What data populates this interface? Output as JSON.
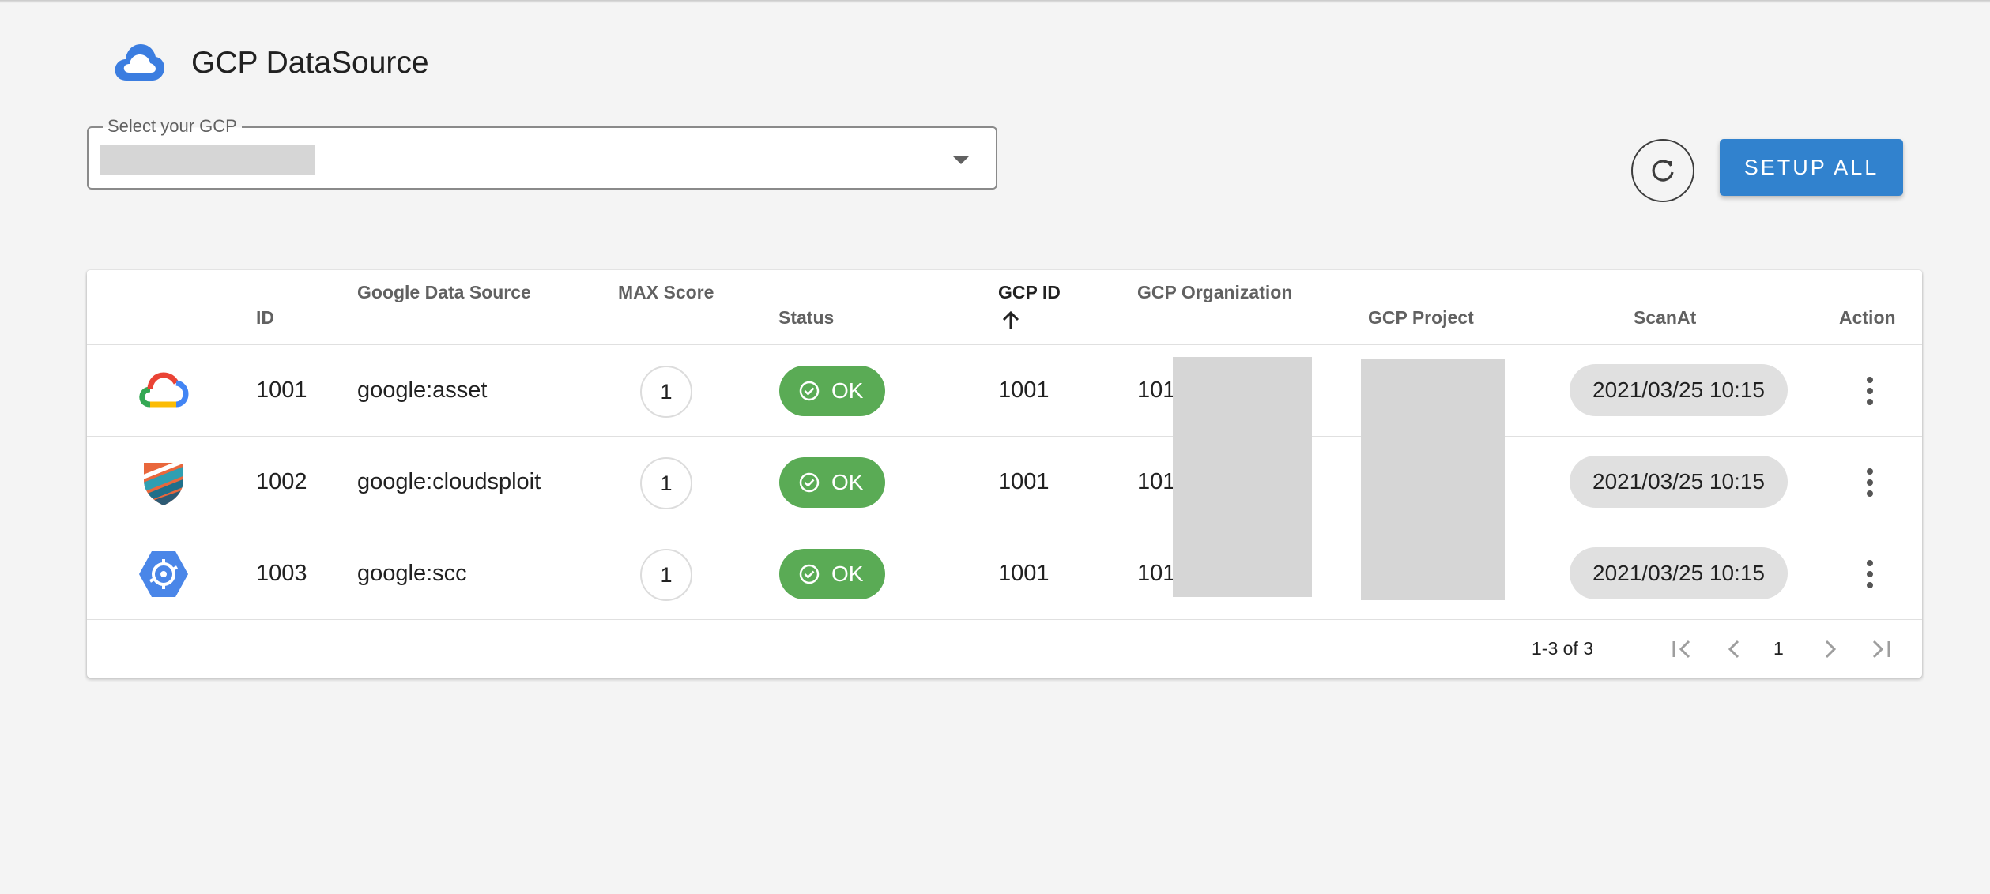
{
  "header": {
    "title": "GCP DataSource",
    "logo_icon": "google-cloud-logo-icon"
  },
  "gcp_select": {
    "label": "Select your GCP",
    "value": ""
  },
  "actions": {
    "refresh_icon": "refresh-icon",
    "setup_all_label": "SETUP ALL"
  },
  "table": {
    "columns": [
      "ID",
      "Google Data Source",
      "MAX Score",
      "Status",
      "GCP ID",
      "GCP Organization",
      "GCP Project",
      "ScanAt",
      "Action"
    ],
    "sort": {
      "column": "GCP ID",
      "direction": "ascending",
      "icon": "arrow-up-icon"
    },
    "rows": [
      {
        "icon": "google-cloud-icon",
        "id": "1001",
        "source": "google:asset",
        "max_score": "1",
        "status": "OK",
        "gcp_id": "1001",
        "gcp_org": "101",
        "gcp_project": "",
        "scan_at": "2021/03/25 10:15"
      },
      {
        "icon": "cloudsploit-shield-icon",
        "id": "1002",
        "source": "google:cloudsploit",
        "max_score": "1",
        "status": "OK",
        "gcp_id": "1001",
        "gcp_org": "101",
        "gcp_project": "",
        "scan_at": "2021/03/25 10:15"
      },
      {
        "icon": "security-command-center-icon",
        "id": "1003",
        "source": "google:scc",
        "max_score": "1",
        "status": "OK",
        "gcp_id": "1001",
        "gcp_org": "101",
        "gcp_project": "",
        "scan_at": "2021/03/25 10:15"
      }
    ]
  },
  "pagination": {
    "range_text": "1-3 of 3",
    "page": "1"
  },
  "colors": {
    "primary": "#3182ce",
    "ok_green": "#5aab55",
    "chip_grey": "#e0e0e0",
    "background": "#f4f4f4"
  }
}
